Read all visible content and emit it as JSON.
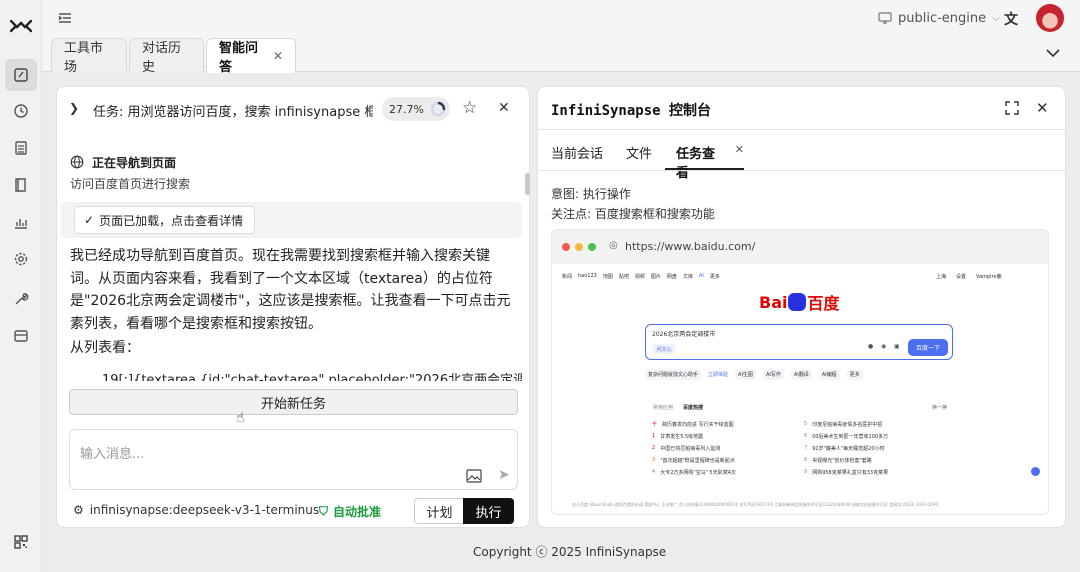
{
  "sidebar": {
    "logo": "logo-icon",
    "items": [
      {
        "name": "edit-icon",
        "active": true
      },
      {
        "name": "history-icon"
      },
      {
        "name": "list-icon"
      },
      {
        "name": "book-icon"
      },
      {
        "name": "chart-icon"
      },
      {
        "name": "gear-icon"
      },
      {
        "name": "wrench-icon"
      },
      {
        "name": "card-icon"
      }
    ],
    "bottom": "qrcode-icon"
  },
  "topbar": {
    "engine_label": "public-engine",
    "translate_icon": "translate-icon",
    "avatar": "avatar"
  },
  "tabs": [
    {
      "label": "工具市场"
    },
    {
      "label": "对话历史"
    },
    {
      "label": "智能问答",
      "active": true
    }
  ],
  "task": {
    "title": "任务: 用浏览器访问百度，搜索 infinisynapse 框...",
    "progress_text": "27.7%",
    "progress": 0.277
  },
  "chat": {
    "nav_title": "正在导航到页面",
    "nav_sub": "访问百度首页进行搜索",
    "loaded_label": "页面已加载，点击查看详情",
    "paragraph": "我已经成功导航到百度首页。现在我需要找到搜索框并输入搜索关键词。从页面内容来看，我看到了一个文本区域（textarea）的占位符是\"2026北京两会定调楼市\"，这应该是搜索框。让我查看一下可点击元素列表，看看哪个是搜索框和搜索按钮。",
    "list_intro": "从列表看：",
    "list_item": "19[:]{textarea {id:\"chat-textarea\",placeholder:\"2026北京两会定调"
  },
  "new_task_label": "开始新任务",
  "input": {
    "placeholder": "输入消息..."
  },
  "footer_bar": {
    "model": "infinisynapse:deepseek-v3-1-terminus",
    "auto_approve": "自动批准",
    "plan_label": "计划",
    "execute_label": "执行"
  },
  "console": {
    "title": "InfiniSynapse 控制台",
    "tabs": [
      {
        "label": "当前会话"
      },
      {
        "label": "文件"
      },
      {
        "label": "任务查看",
        "active": true
      }
    ],
    "intent": "意图: 执行操作",
    "focus": "关注点: 百度搜索框和搜索功能",
    "browser_url": "https://www.baidu.com/"
  },
  "baidu": {
    "nav_links": [
      "新闻",
      "hao123",
      "地图",
      "贴吧",
      "视频",
      "图片",
      "网盘",
      "文库",
      "AI",
      "更多"
    ],
    "user_links": [
      "上海",
      "设置",
      "Vampire鹿"
    ],
    "logo_text": "Bai",
    "logo_text2": "百度",
    "search_text": "2026北京两会定调楼市",
    "ask_label": "问文心",
    "search_button": "百度一下",
    "ai_chips": [
      "复杂问题就找文心助手",
      "立即体验",
      "AI生图",
      "AI写作",
      "AI翻译",
      "AI编程",
      "更多"
    ],
    "hot_tabs": [
      "常用应用",
      "百度热搜"
    ],
    "refresh": "换一换",
    "hot_left": [
      "跨历春发向前进 写行实干绘蓝图",
      "甘肃发生5.5级地震",
      "中国已将厄帕病毒列入监测",
      "\"首次超越\"既是里程碑也是新起点",
      "大专2万多网购\"宝马\" 5天趴窝4次"
    ],
    "hot_left_nums": [
      "千",
      "1",
      "2",
      "3",
      "4"
    ],
    "hot_right": [
      "印度尼帕病毒疫情多名医护中招",
      "00后美术生到匿一年营收100多万",
      "92岁\"藤美人\"每天睡觉超20小时",
      "央视曝光\"低价体检套\"套路",
      "网购958克菜果礼盒只有33克菜果"
    ],
    "hot_right_nums": [
      "5",
      "6",
      "7",
      "8",
      "9"
    ],
    "footer": "关于百度  About Baidu  使用百度前必读  帮助中心  企业推广  京公网安备11000002000001号  京ICP证030173号  互联网新闻信息服务许可证11220180008  网络文化经营许可证  信网文(2023) 1034-029号"
  },
  "copyright": "Copyright ⓒ 2025 InfiniSynapse",
  "colors": {
    "baidu_red": "#e10602",
    "baidu_blue": "#2932e1",
    "search_btn": "#4e6ef2",
    "approve_green": "#1a9a3a"
  }
}
